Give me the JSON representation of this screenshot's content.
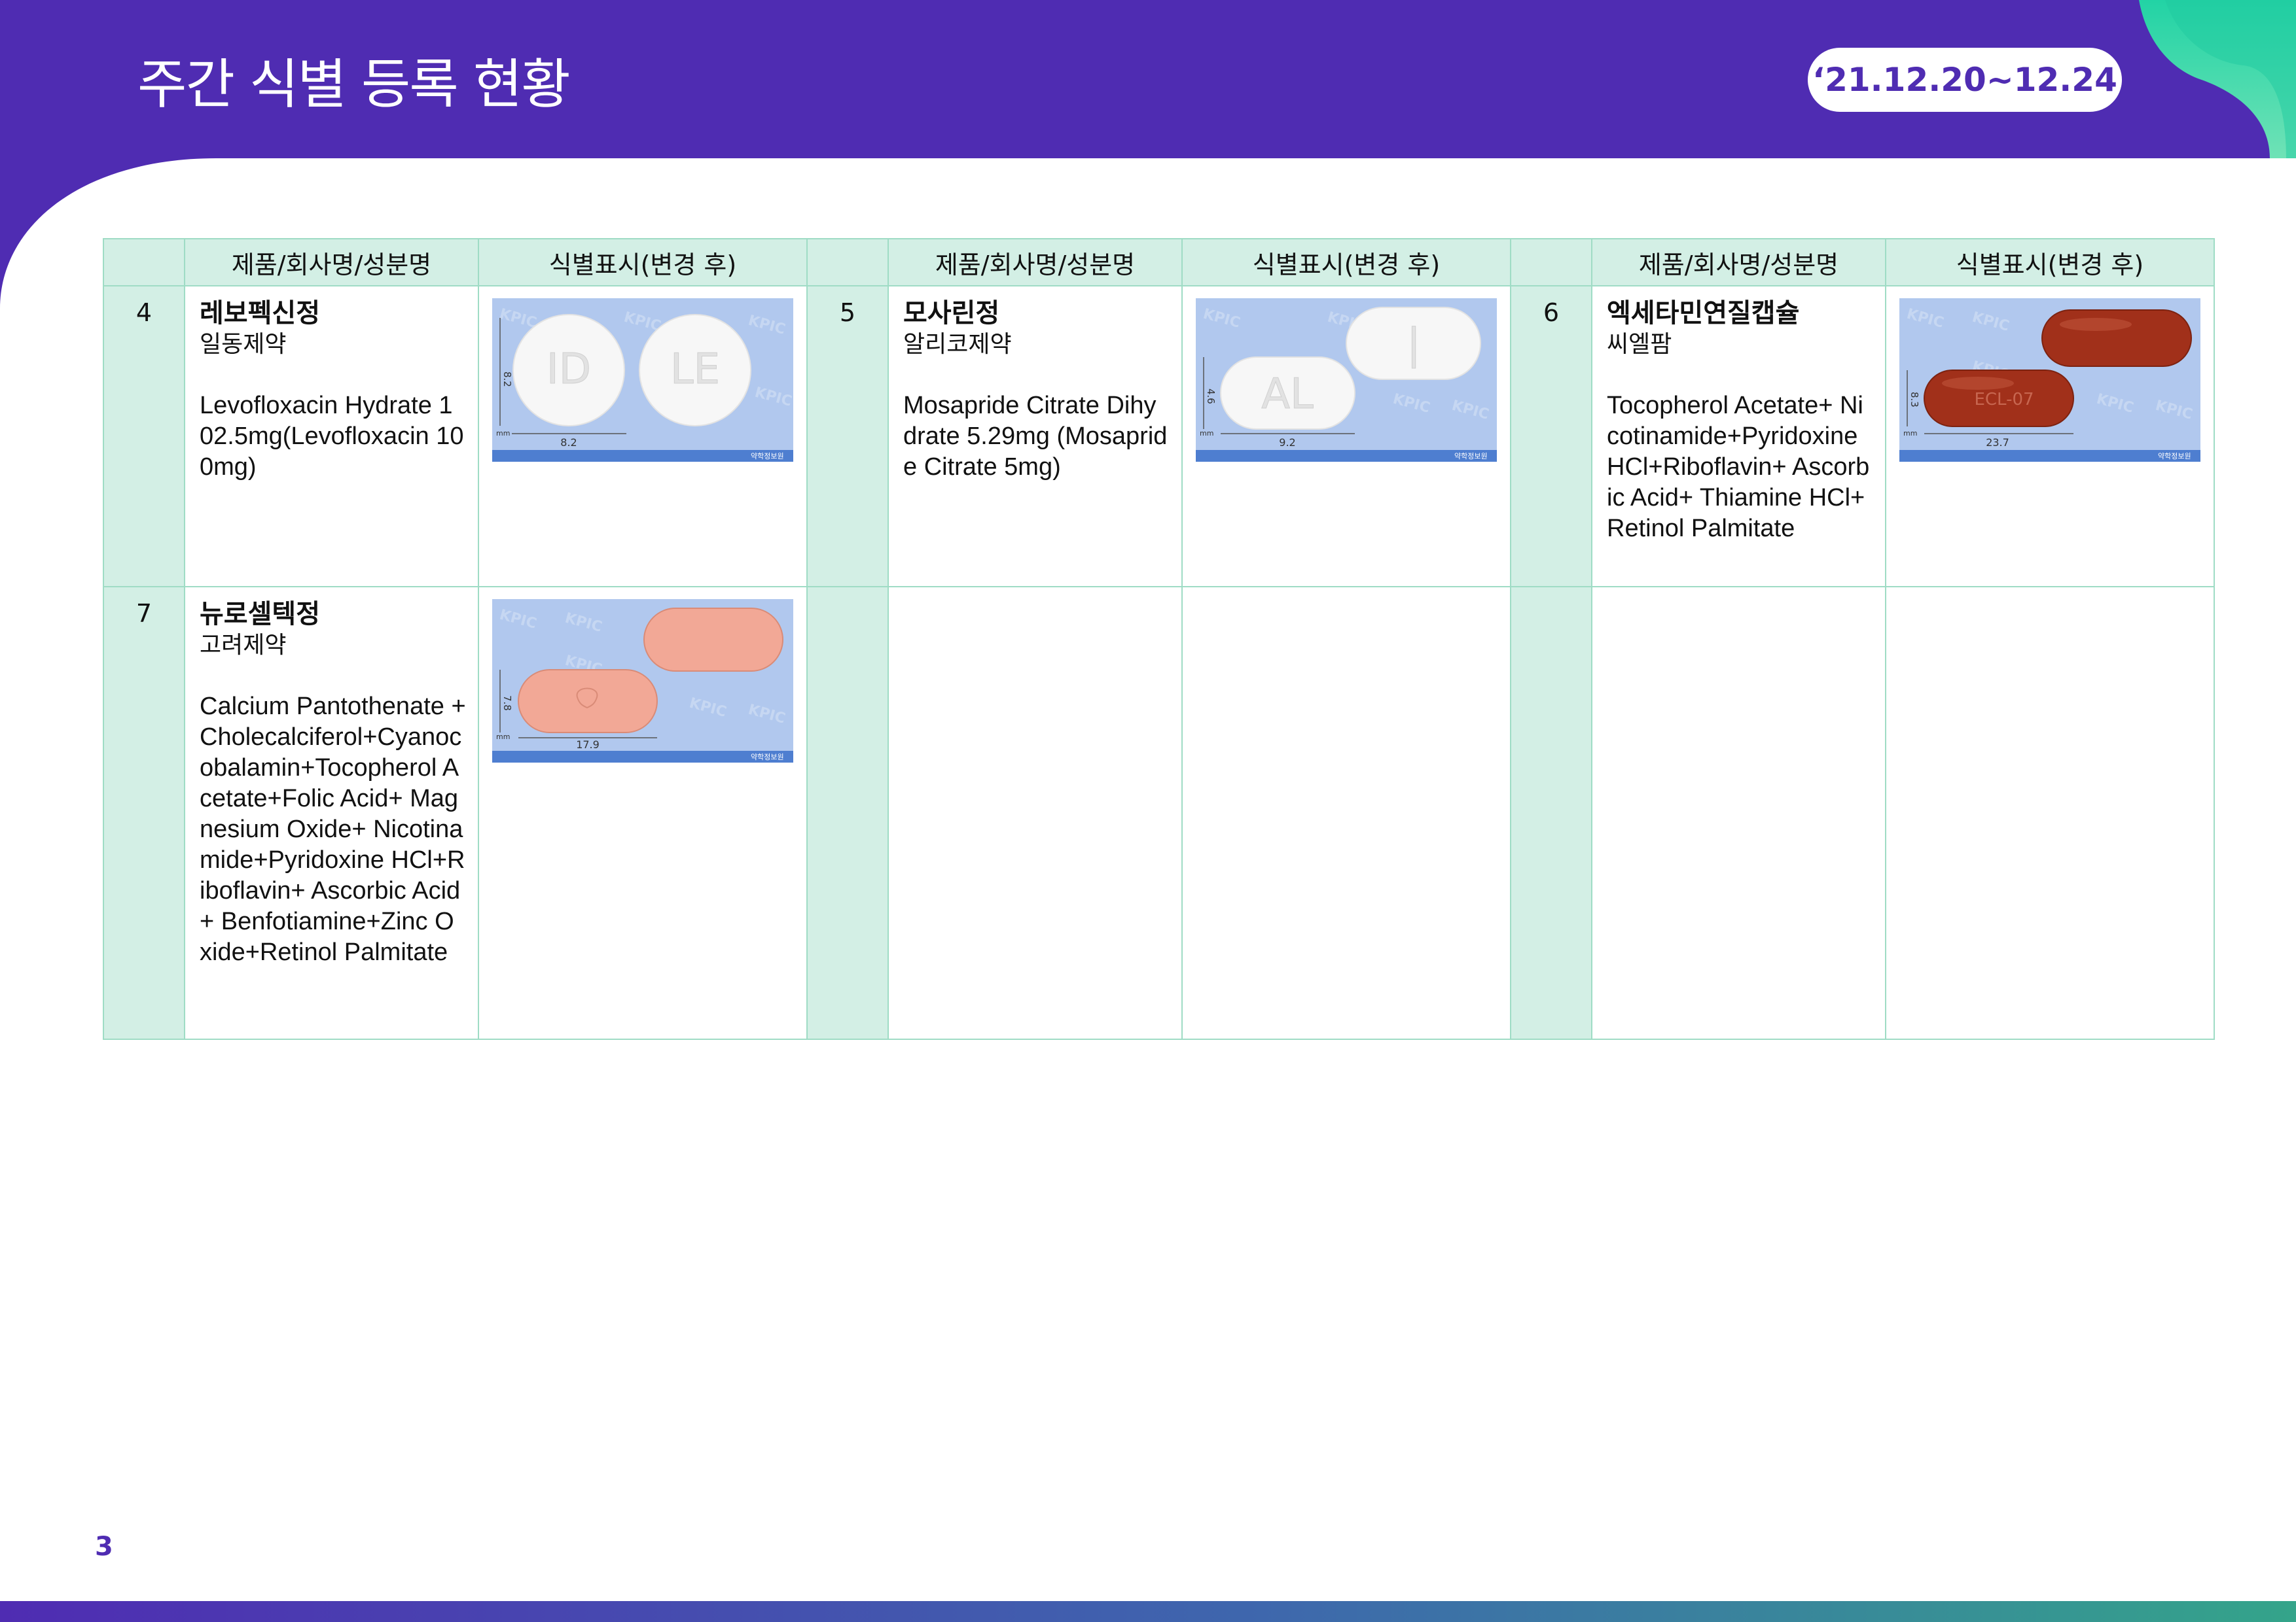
{
  "header": {
    "title": "주간 식별 등록 현황",
    "date_range": "‘21.12.20~12.24"
  },
  "table": {
    "headers": [
      "제품/회사명/성분명",
      "식별표시(변경 후)",
      "제품/회사명/성분명",
      "식별표시(변경 후)",
      "제품/회사명/성분명",
      "식별표시(변경 후)"
    ],
    "rows": [
      [
        {
          "no": "4",
          "product": "레보펙신정",
          "company": "일동제약",
          "ingredients": "Levofloxacin Hydrate 102.5mg(Levofloxacin 100mg)",
          "image": {
            "marks": [
              "ID",
              "LE"
            ],
            "dim_v": "8.2",
            "dim_h": "8.2",
            "unit": "mm",
            "watermark": "KPIC",
            "footer": "약학정보원",
            "pill_color": "#FAFAFA"
          }
        },
        {
          "no": "5",
          "product": "모사린정",
          "company": "알리코제약",
          "ingredients": "Mosapride Citrate Dihydrate 5.29mg (Mosapride Citrate 5mg)",
          "image": {
            "marks": [
              "AL",
              "|"
            ],
            "dim_v": "4.6",
            "dim_h": "9.2",
            "unit": "mm",
            "watermark": "KPIC",
            "footer": "약학정보원",
            "pill_color": "#FAFAFA"
          }
        },
        {
          "no": "6",
          "product": "엑세타민연질캡슐",
          "company": "씨엘팜",
          "ingredients": "Tocopherol Acetate+ Nicotinamide+Pyridoxine HCl+Riboflavin+ Ascorbic Acid+ Thiamine HCl+Retinol Palmitate",
          "image": {
            "marks": [
              "",
              "ECL-07"
            ],
            "dim_v": "8.3",
            "dim_h": "23.7",
            "unit": "mm",
            "watermark": "KPIC",
            "footer": "약학정보원",
            "pill_color": "#A1301A"
          }
        }
      ],
      [
        {
          "no": "7",
          "product": "뉴로셀텍정",
          "company": "고려제약",
          "ingredients": "Calcium Pantothenate +Cholecalciferol+Cyanocobalamin+Tocopherol Acetate+Folic Acid+ Magnesium Oxide+ Nicotinamide+Pyridoxine HCl+Riboflavin+ Ascorbic Acid+ Benfotiamine+Zinc Oxide+Retinol Palmitate",
          "image": {
            "marks": [
              "",
              "logo"
            ],
            "dim_v": "7.8",
            "dim_h": "17.9",
            "unit": "mm",
            "watermark": "KPIC",
            "footer": "약학정보원",
            "pill_color": "#F2A896"
          }
        }
      ]
    ]
  },
  "page_number": "3",
  "colors": {
    "brand_purple": "#4F2CB2",
    "table_border": "#9FDCC5",
    "table_header_bg": "#D3EFE5",
    "accent_teal": "#22D3A5"
  }
}
